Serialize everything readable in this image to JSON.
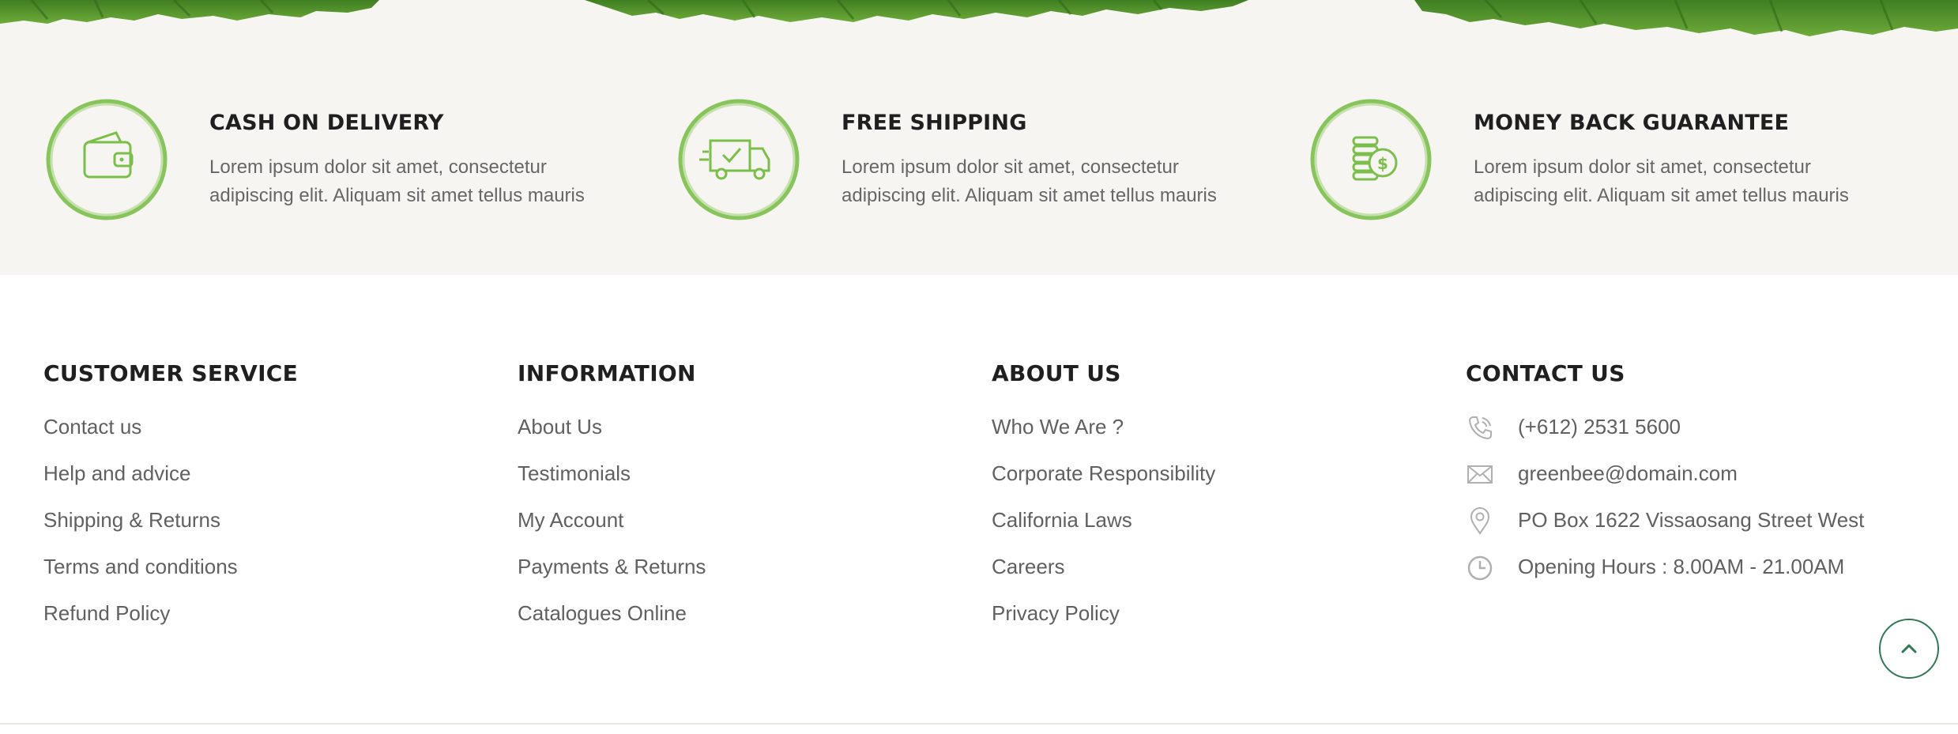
{
  "colors": {
    "accent_green": "#7bbf4a",
    "grass_green": "#4e8f2a",
    "heading": "#1f1f1f",
    "body_text": "#666666",
    "strip_bg": "#f6f5f2",
    "back_to_top": "#2f7a52"
  },
  "features": [
    {
      "icon": "wallet-icon",
      "title": "CASH ON DELIVERY",
      "desc": "Lorem ipsum dolor sit amet, consectetur adipiscing elit. Aliquam sit amet tellus mauris"
    },
    {
      "icon": "delivery-truck-icon",
      "title": "FREE SHIPPING",
      "desc": "Lorem ipsum dolor sit amet, consectetur adipiscing elit. Aliquam sit amet tellus mauris"
    },
    {
      "icon": "coins-icon",
      "title": "MONEY BACK GUARANTEE",
      "desc": "Lorem ipsum dolor sit amet, consectetur adipiscing elit. Aliquam sit amet tellus mauris"
    }
  ],
  "footer": {
    "customer_service": {
      "heading": "CUSTOMER SERVICE",
      "links": [
        "Contact us",
        "Help and advice",
        "Shipping & Returns",
        "Terms and conditions",
        "Refund Policy"
      ]
    },
    "information": {
      "heading": "INFORMATION",
      "links": [
        "About Us",
        "Testimonials",
        "My Account",
        "Payments & Returns",
        "Catalogues Online"
      ]
    },
    "about_us": {
      "heading": "ABOUT US",
      "links": [
        "Who We Are ?",
        "Corporate Responsibility",
        "California Laws",
        "Careers",
        "Privacy Policy"
      ]
    },
    "contact_us": {
      "heading": "CONTACT US",
      "items": [
        {
          "icon": "phone-icon",
          "text": "(+612) 2531 5600"
        },
        {
          "icon": "mail-icon",
          "text": "greenbee@domain.com"
        },
        {
          "icon": "location-pin-icon",
          "text": "PO Box 1622 Vissaosang Street West"
        },
        {
          "icon": "clock-icon",
          "text": "Opening Hours : 8.00AM - 21.00AM"
        }
      ]
    }
  },
  "back_to_top": {
    "icon": "chevron-up-icon"
  }
}
